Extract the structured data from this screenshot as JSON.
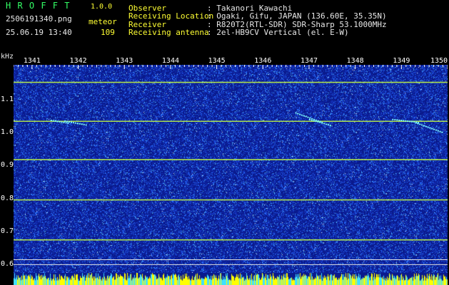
{
  "app": {
    "title": "H R O F F T",
    "version": "1.0.0",
    "file_name": "2506191340.png",
    "date_time": "25.06.19 13:40",
    "mode_label": "meteor",
    "count": "109"
  },
  "info": {
    "observer_label": "Observer",
    "observer_value": ": Takanori Kawachi",
    "location_label": "Receiving Location",
    "location_value": ": Ogaki, Gifu, JAPAN (136.60E, 35.35N)",
    "receiver_label": "Receiver",
    "receiver_value": ": R820T2(RTL-SDR) SDR-Sharp 53.1000MHz",
    "antenna_label": "Receiving antenna",
    "antenna_value": ": 2el-HB9CV Vertical (el. E-W)"
  },
  "chart_data": {
    "type": "heatmap",
    "ylabel": "kHz",
    "y_ticks": [
      "1.1",
      "1.0",
      "0.9",
      "0.8",
      "0.7",
      "0.6"
    ],
    "x_ticks": [
      "1341",
      "1342",
      "1343",
      "1344",
      "1345",
      "1346",
      "1347",
      "1348",
      "1349",
      "1350"
    ],
    "xlim": [
      1340.6,
      1350.0
    ],
    "ylim": [
      0.575,
      1.205
    ],
    "carrier_lines_khz": [
      1.152,
      1.034,
      0.918,
      0.796,
      0.675
    ],
    "reference_lines_khz": [
      0.615,
      0.6
    ],
    "meteor_echoes": [
      {
        "t_start": 1341.4,
        "t_end": 1341.8,
        "f_start": 1.037,
        "f_end": 1.028
      },
      {
        "t_start": 1341.7,
        "t_end": 1342.2,
        "f_start": 1.035,
        "f_end": 1.022
      },
      {
        "t_start": 1346.7,
        "t_end": 1347.3,
        "f_start": 1.06,
        "f_end": 1.03
      },
      {
        "t_start": 1347.0,
        "t_end": 1347.5,
        "f_start": 1.04,
        "f_end": 1.02
      },
      {
        "t_start": 1348.8,
        "t_end": 1349.4,
        "f_start": 1.04,
        "f_end": 1.03
      },
      {
        "t_start": 1349.3,
        "t_end": 1349.9,
        "f_start": 1.03,
        "f_end": 1.0
      }
    ],
    "colors": {
      "background": "#0a1a8c",
      "noise": "#2a6cff",
      "carrier": "#c8ff40",
      "reference": "#e0e0e0",
      "bar": "#ffff00"
    }
  }
}
